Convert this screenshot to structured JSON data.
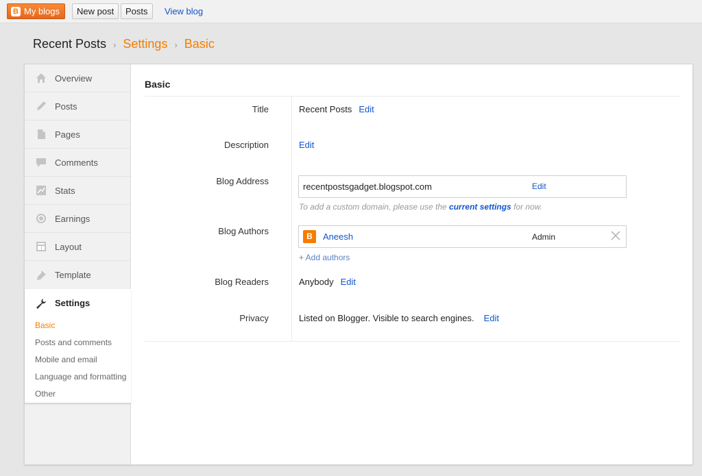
{
  "topbar": {
    "my_blogs_label": "My blogs",
    "new_post_label": "New post",
    "posts_label": "Posts",
    "view_blog_label": "View blog"
  },
  "breadcrumb": {
    "blog_name": "Recent Posts",
    "section": "Settings",
    "page": "Basic",
    "separator": "›"
  },
  "sidebar": {
    "items": [
      {
        "label": "Overview",
        "icon": "home-icon"
      },
      {
        "label": "Posts",
        "icon": "pencil-icon"
      },
      {
        "label": "Pages",
        "icon": "page-icon"
      },
      {
        "label": "Comments",
        "icon": "comment-icon"
      },
      {
        "label": "Stats",
        "icon": "stats-icon"
      },
      {
        "label": "Earnings",
        "icon": "earnings-icon"
      },
      {
        "label": "Layout",
        "icon": "layout-icon"
      },
      {
        "label": "Template",
        "icon": "template-icon"
      }
    ],
    "active": {
      "label": "Settings",
      "icon": "wrench-icon",
      "subitems": [
        "Basic",
        "Posts and comments",
        "Mobile and email",
        "Language and formatting",
        "Other"
      ]
    }
  },
  "settings": {
    "section_title": "Basic",
    "title_label": "Title",
    "title_value": "Recent Posts",
    "description_label": "Description",
    "blog_address_label": "Blog Address",
    "blog_address_value": "recentpostsgadget.blogspot.com",
    "custom_domain_hint_prefix": "To add a custom domain, please use the",
    "custom_domain_hint_link": "current settings",
    "custom_domain_hint_suffix": "for now.",
    "blog_authors_label": "Blog Authors",
    "author_name": "Aneesh",
    "author_role": "Admin",
    "add_authors_label": "+ Add authors",
    "blog_readers_label": "Blog Readers",
    "blog_readers_value": "Anybody",
    "privacy_label": "Privacy",
    "privacy_value": "Listed on Blogger. Visible to search engines.",
    "edit_label": "Edit"
  },
  "colors": {
    "accent_orange": "#f57d00",
    "link_blue": "#1155cc"
  }
}
